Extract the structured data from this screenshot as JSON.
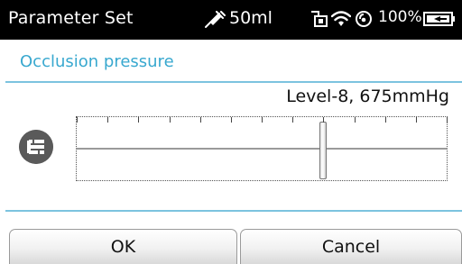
{
  "status_bar": {
    "title": "Parameter Set",
    "volume": "50ml",
    "battery_percent": "100%",
    "icons": [
      "syringe-icon",
      "lock-icon",
      "wifi-icon",
      "signal-icon",
      "battery-icon"
    ]
  },
  "section": {
    "title": "Occlusion pressure"
  },
  "occlusion": {
    "value_text": "Level-8,  675mmHg",
    "level": 8,
    "max_level": 12,
    "icon": "occlusion-icon"
  },
  "buttons": {
    "ok_label": "OK",
    "cancel_label": "Cancel"
  },
  "colors": {
    "status_bar_bg": "#000000",
    "accent": "#38a8cf",
    "divider": "#7cc3df",
    "icon_bg": "#5a5a5a"
  }
}
